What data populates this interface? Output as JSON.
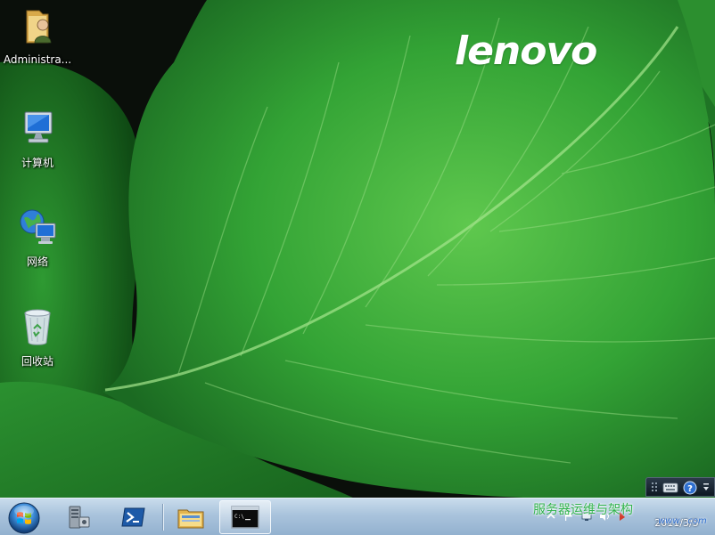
{
  "wallpaper": {
    "brand": "lenovo",
    "colors": {
      "leaf_main": "#35a53a",
      "leaf_light": "#6bd05d",
      "leaf_dark": "#1f6e25",
      "background": "#0a0f0a"
    }
  },
  "desktop_icons": [
    {
      "label": "Administra...",
      "icon": "user-folder-icon"
    },
    {
      "label": "计算机",
      "icon": "computer-icon"
    },
    {
      "label": "网络",
      "icon": "network-icon"
    },
    {
      "label": "回收站",
      "icon": "recycle-bin-icon"
    }
  ],
  "taskbar": {
    "start_icon": "windows-orb-icon",
    "pinned": [
      {
        "icon": "server-manager-icon"
      },
      {
        "icon": "powershell-icon"
      },
      {
        "icon": "windows-explorer-icon"
      },
      {
        "icon": "command-prompt-icon",
        "active": true
      }
    ],
    "tray_icons": [
      "show-hidden-icons-arrow",
      "flag-icon",
      "network-tray-icon",
      "volume-icon",
      "action-center-icon"
    ],
    "clock": {
      "date": "2011/3/5"
    },
    "colors": {
      "bar_top": "#c9dcec",
      "bar_bottom": "#93b1cf"
    }
  },
  "language_bar": {
    "icons": [
      "keyboard-icon",
      "help-icon",
      "options-arrow-icon"
    ]
  },
  "watermark": {
    "text": "服务器运维与架构",
    "sub": "www.  .com"
  }
}
